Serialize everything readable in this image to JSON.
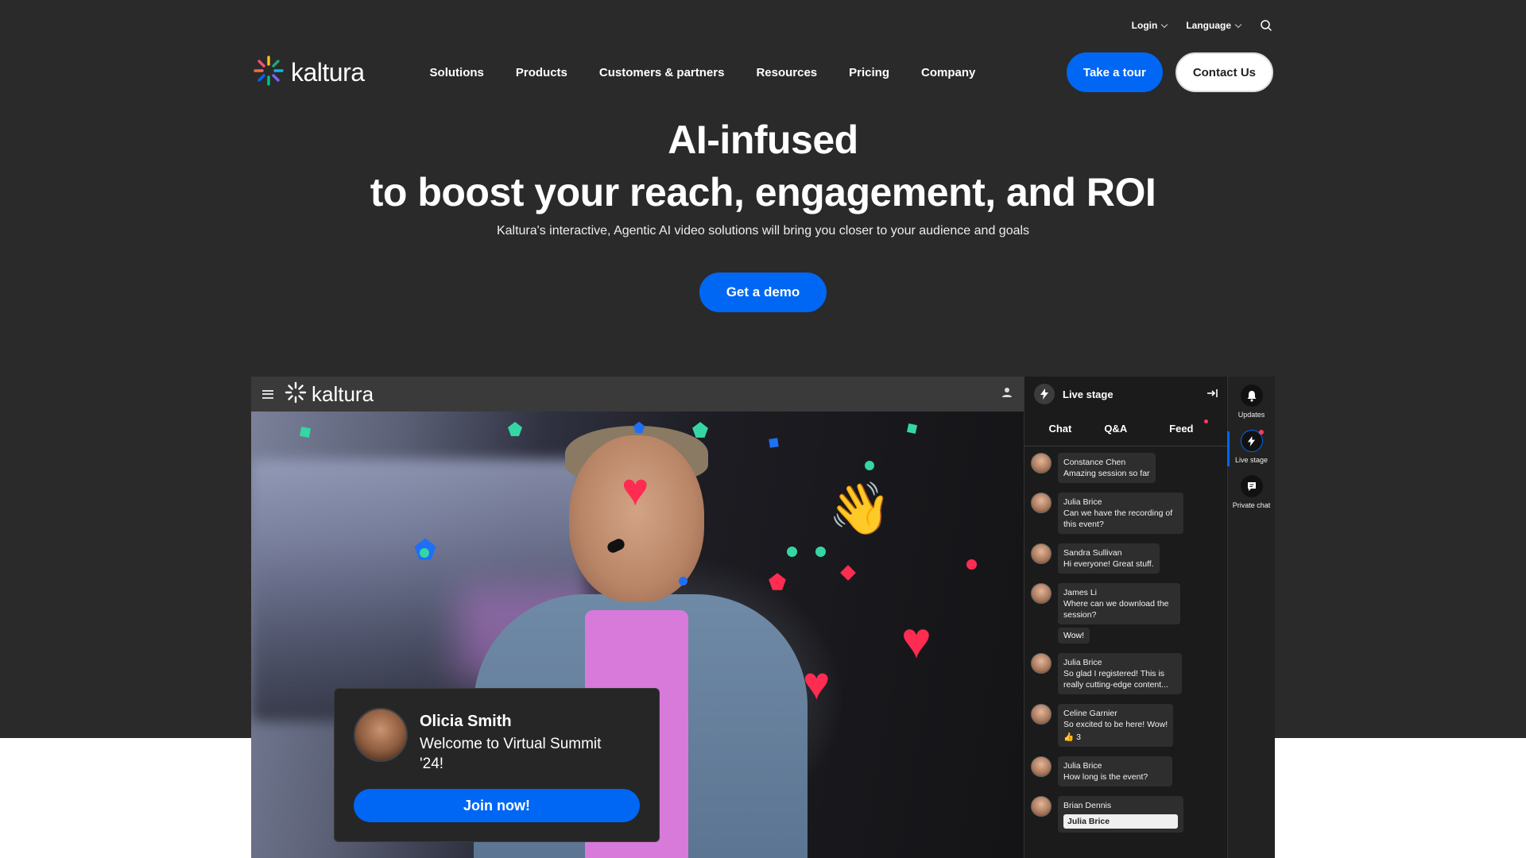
{
  "utility": {
    "login_label": "Login",
    "language_label": "Language"
  },
  "nav": {
    "logo_text": "kaltura",
    "items": [
      {
        "label": "Solutions"
      },
      {
        "label": "Products"
      },
      {
        "label": "Customers & partners"
      },
      {
        "label": "Resources"
      },
      {
        "label": "Pricing"
      },
      {
        "label": "Company"
      }
    ],
    "tour_label": "Take a tour",
    "contact_label": "Contact Us"
  },
  "hero": {
    "title_line1": "AI-infused",
    "title_line2": "to boost your reach, engagement, and ROI",
    "subtitle": "Kaltura's interactive, Agentic AI video solutions will bring you closer to your audience and goals",
    "demo_label": "Get a demo"
  },
  "mock": {
    "logo_text": "kaltura",
    "welcome": {
      "name": "Olicia Smith",
      "message": "Welcome to Virtual Summit '24!",
      "join_label": "Join now!"
    },
    "panel": {
      "title": "Live stage",
      "tabs": [
        {
          "label": "Chat"
        },
        {
          "label": "Q&A"
        },
        {
          "label": "Feed"
        }
      ],
      "messages": [
        {
          "name": "Constance Chen",
          "text": "Amazing session so far"
        },
        {
          "name": "Julia Brice",
          "text": "Can we have the recording of this event?"
        },
        {
          "name": "Sandra Sullivan",
          "text": "Hi everyone! Great stuff."
        },
        {
          "name": "James Li",
          "text": "Where can we download the session?",
          "extra": "Wow!"
        },
        {
          "name": "Julia Brice",
          "text": "So glad I registered! This is really cutting-edge content..."
        },
        {
          "name": "Celine Garnier",
          "text": "So excited to be here! Wow!",
          "likes": "3"
        },
        {
          "name": "Julia Brice",
          "text": "How long is the event?"
        },
        {
          "name": "Brian Dennis",
          "quote": "Julia Brice"
        }
      ]
    },
    "rail": {
      "updates_label": "Updates",
      "live_label": "Live stage",
      "private_label": "Private chat"
    }
  },
  "colors": {
    "brand_blue": "#0067f4",
    "hero_bg": "#2a2a2a",
    "accent_red": "#ff3b5c"
  }
}
